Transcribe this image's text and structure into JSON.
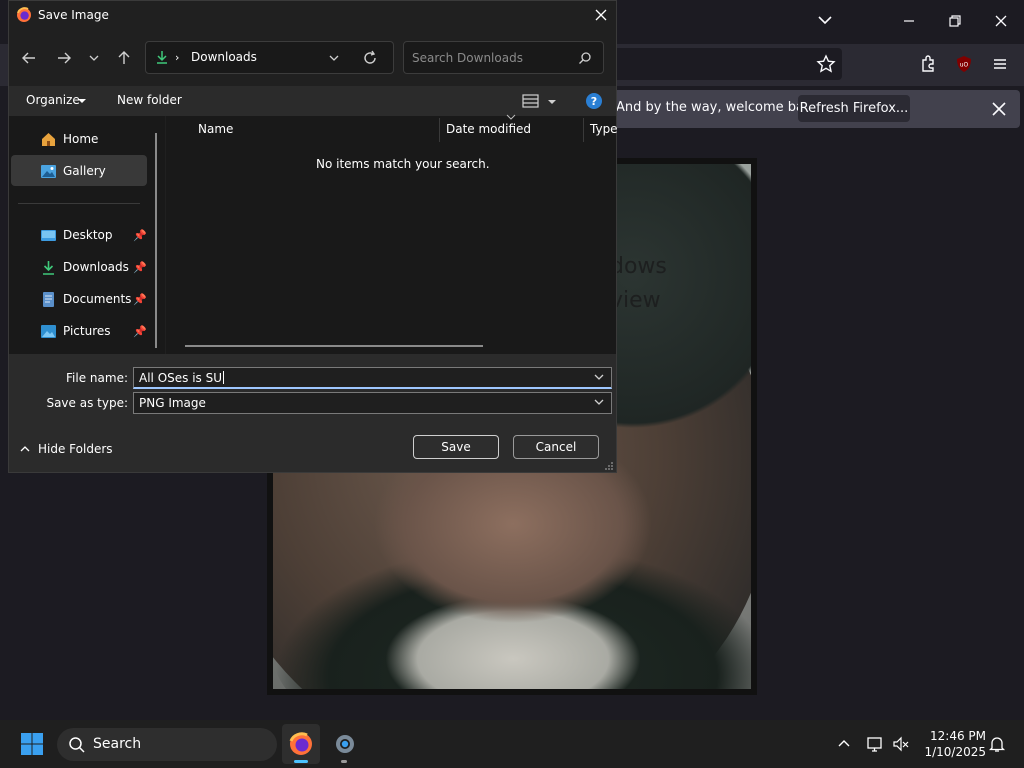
{
  "firefox": {
    "infobar_text": "And by the way, welcome back!",
    "refresh_label": "Refresh Firefox...",
    "photo_text_line1": "dows",
    "photo_text_line2": "view"
  },
  "dialog": {
    "title": "Save Image",
    "address": "Downloads",
    "search_placeholder": "Search Downloads",
    "organize_label": "Organize",
    "new_folder_label": "New folder",
    "nav_items": [
      {
        "label": "Home",
        "icon": "home-icon"
      },
      {
        "label": "Gallery",
        "icon": "gallery-icon"
      },
      {
        "label": "Desktop",
        "icon": "desktop-icon",
        "pinned": true
      },
      {
        "label": "Downloads",
        "icon": "download-icon",
        "pinned": true
      },
      {
        "label": "Documents",
        "icon": "document-icon",
        "pinned": true
      },
      {
        "label": "Pictures",
        "icon": "pictures-icon",
        "pinned": true
      }
    ],
    "columns": {
      "name": "Name",
      "date_modified": "Date modified",
      "type": "Type"
    },
    "empty_message": "No items match your search.",
    "file_name_label": "File name:",
    "file_name_value": "All OSes is SU",
    "save_type_label": "Save as type:",
    "save_type_value": "PNG Image",
    "save_label": "Save",
    "cancel_label": "Cancel",
    "hide_folders_label": "Hide Folders"
  },
  "taskbar": {
    "search_label": "Search",
    "time": "12:46 PM",
    "date": "1/10/2025"
  },
  "colors": {
    "dialog_bg": "#202020",
    "accent_download": "#3fc97a",
    "help_blue": "#2a7fd4",
    "ublock_red": "#800000"
  }
}
